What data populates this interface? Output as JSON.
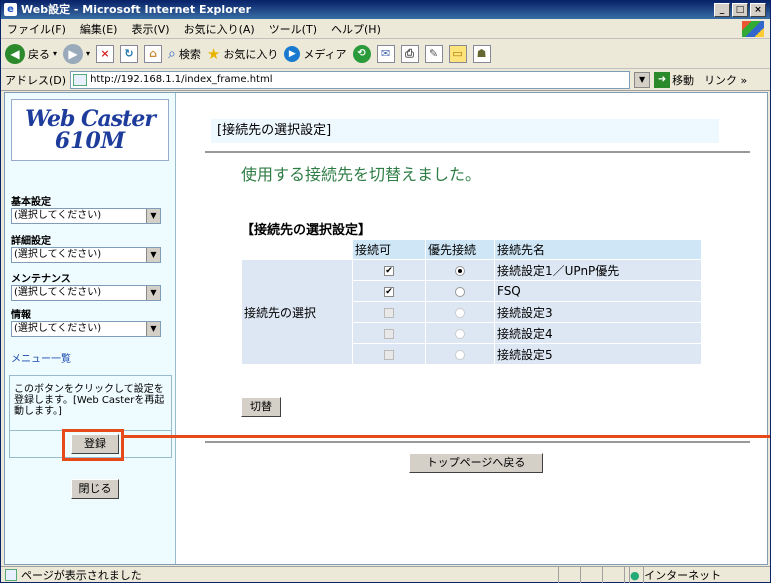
{
  "window": {
    "title": "Web設定 - Microsoft Internet Explorer"
  },
  "menubar": [
    "ファイル(F)",
    "編集(E)",
    "表示(V)",
    "お気に入り(A)",
    "ツール(T)",
    "ヘルプ(H)"
  ],
  "toolbar": {
    "back": "戻る",
    "search": "検索",
    "favorites": "お気に入り",
    "media": "メディア"
  },
  "address": {
    "label": "アドレス(D)",
    "url": "http://192.168.1.1/index_frame.html",
    "go": "移動",
    "links": "リンク »"
  },
  "sidebar": {
    "logo_line1": "Web Caster",
    "logo_line2": "610M",
    "groups": [
      {
        "label": "基本設定",
        "value": "(選択してください)"
      },
      {
        "label": "詳細設定",
        "value": "(選択してください)"
      },
      {
        "label": "メンテナンス",
        "value": "(選択してください)"
      },
      {
        "label": "情報",
        "value": "(選択してください)"
      }
    ],
    "menu_link": "メニュー一覧",
    "note": "このボタンをクリックして設定を登録します。[Web Casterを再起動します。]",
    "register_button": "登録",
    "close_button": "閉じる"
  },
  "main": {
    "title": "[接続先の選択設定]",
    "message": "使用する接続先を切替えました。",
    "section_title": "【接続先の選択設定】",
    "headers": [
      "接続可",
      "優先接続",
      "接続先名"
    ],
    "row_label": "接続先の選択",
    "rows": [
      {
        "enabled": true,
        "checkbox_active": true,
        "priority": true,
        "radio_active": true,
        "name": "接続設定1／UPnP優先"
      },
      {
        "enabled": true,
        "checkbox_active": true,
        "priority": false,
        "radio_active": true,
        "name": "FSQ"
      },
      {
        "enabled": false,
        "checkbox_active": false,
        "priority": false,
        "radio_active": false,
        "name": "接続設定3"
      },
      {
        "enabled": false,
        "checkbox_active": false,
        "priority": false,
        "radio_active": false,
        "name": "接続設定4"
      },
      {
        "enabled": false,
        "checkbox_active": false,
        "priority": false,
        "radio_active": false,
        "name": "接続設定5"
      }
    ],
    "switch_button": "切替",
    "top_button": "トップページへ戻る"
  },
  "status": {
    "text": "ページが表示されました",
    "zone": "インターネット"
  },
  "colors": {
    "message": "#2e7d44",
    "highlight": "#e64a19",
    "sidebar_bg": "#eefbff"
  }
}
